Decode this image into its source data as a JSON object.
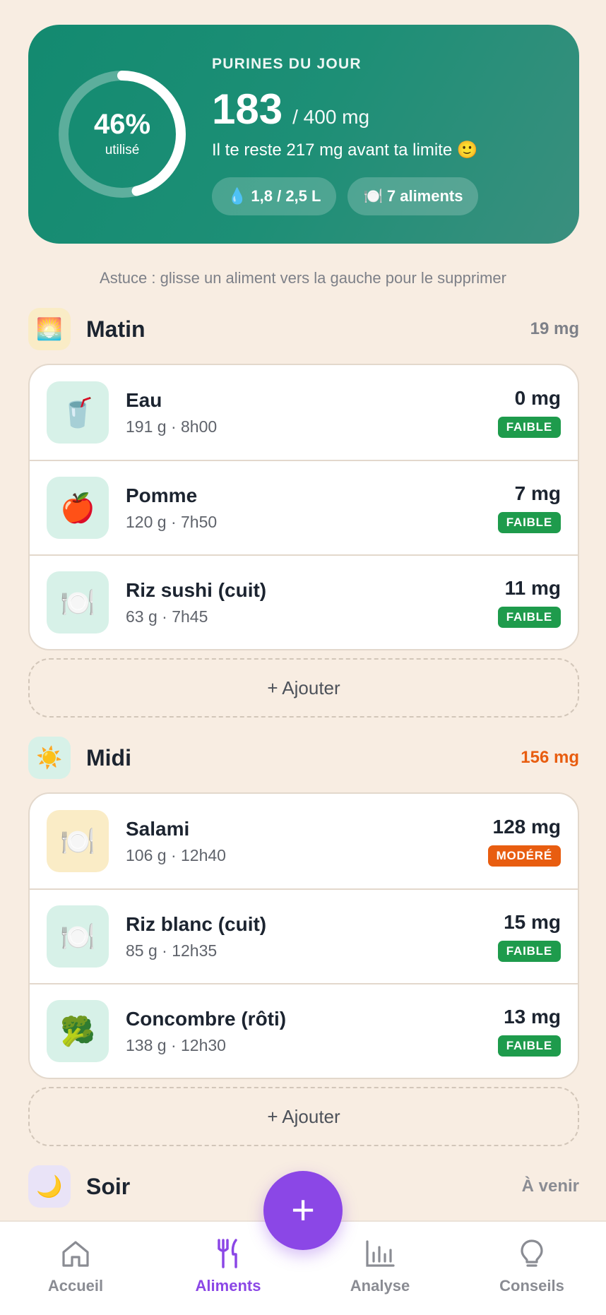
{
  "summary": {
    "label": "PURINES DU JOUR",
    "value": "183",
    "unit": "/ 400 mg",
    "percent": "46%",
    "percent_sub": "utilisé",
    "percent_fraction": 0.46,
    "message": "Il te reste 217 mg avant ta limite 🙂",
    "chip_water": "1,8 / 2,5 L",
    "chip_water_icon": "💧",
    "chip_foods": "7 aliments",
    "chip_foods_icon": "🍽️"
  },
  "tip": "Astuce : glisse un aliment vers la gauche pour le supprimer",
  "sections": {
    "matin": {
      "title": "Matin",
      "icon": "🌅",
      "total": "19 mg",
      "items": [
        {
          "name": "Eau",
          "meta": "191 g · 8h00",
          "mg": "0 mg",
          "level": "FAIBLE",
          "icon": "🥤"
        },
        {
          "name": "Pomme",
          "meta": "120 g · 7h50",
          "mg": "7 mg",
          "level": "FAIBLE",
          "icon": "🍎"
        },
        {
          "name": "Riz sushi (cuit)",
          "meta": "63 g · 7h45",
          "mg": "11 mg",
          "level": "FAIBLE",
          "icon": "🍽️"
        }
      ],
      "add_label": "+ Ajouter"
    },
    "midi": {
      "title": "Midi",
      "icon": "☀️",
      "total": "156 mg",
      "items": [
        {
          "name": "Salami",
          "meta": "106 g · 12h40",
          "mg": "128 mg",
          "level": "MODÉRÉ",
          "icon": "🍽️"
        },
        {
          "name": "Riz blanc (cuit)",
          "meta": "85 g · 12h35",
          "mg": "15 mg",
          "level": "FAIBLE",
          "icon": "🍽️"
        },
        {
          "name": "Concombre (rôti)",
          "meta": "138 g · 12h30",
          "mg": "13 mg",
          "level": "FAIBLE",
          "icon": "🥦"
        }
      ],
      "add_label": "+ Ajouter"
    },
    "soir": {
      "title": "Soir",
      "icon": "🌙",
      "total": "À venir"
    }
  },
  "fab_label": "+",
  "nav": [
    {
      "label": "Accueil",
      "icon": "home-icon"
    },
    {
      "label": "Aliments",
      "icon": "utensils-icon"
    },
    {
      "label": "Analyse",
      "icon": "bar-chart-icon"
    },
    {
      "label": "Conseils",
      "icon": "lightbulb-icon"
    }
  ],
  "colors": {
    "background": "#f8ede2",
    "card_green": "#1d8f76",
    "low": "#1e9b4c",
    "moderate": "#e85d10",
    "accent": "#8b47e6",
    "icon_bg_green": "#d7f1e8",
    "icon_bg_yellow": "#faecc6"
  }
}
